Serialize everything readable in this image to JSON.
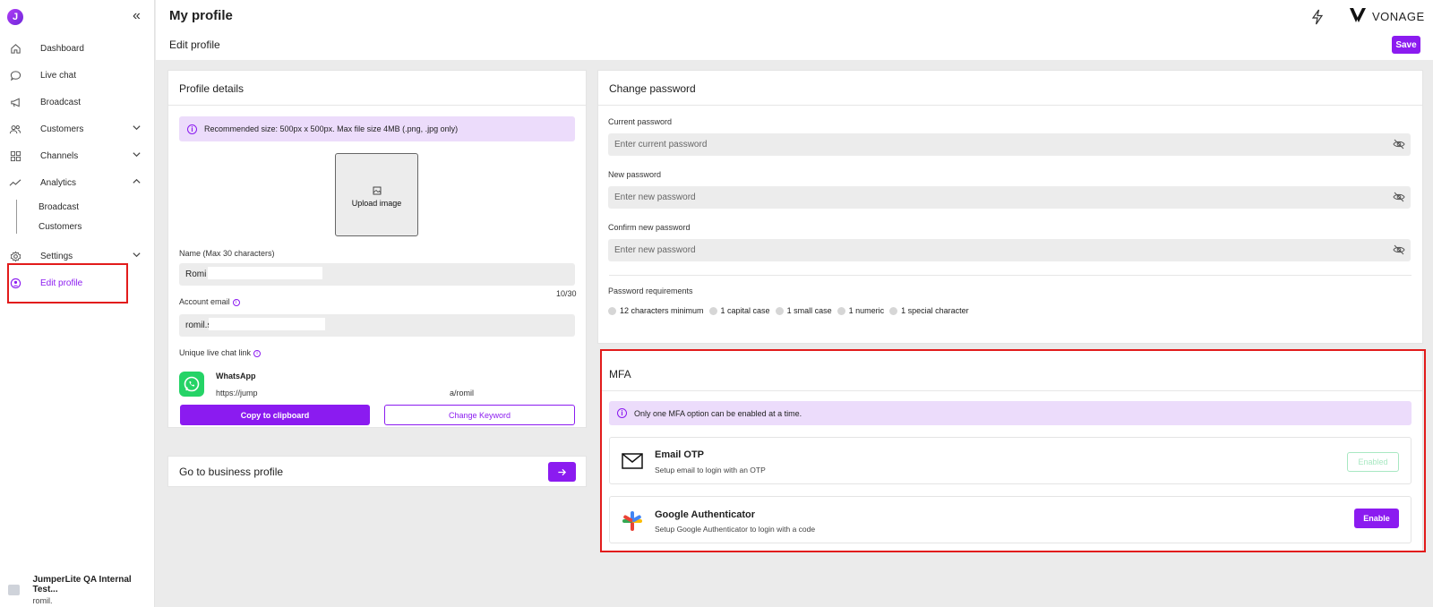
{
  "app": {
    "logo_letter": "J",
    "brand": "VONAGE",
    "accent_color": "#8b1bf0"
  },
  "sidebar": {
    "items": [
      {
        "label": "Dashboard",
        "icon": "home-icon"
      },
      {
        "label": "Live chat",
        "icon": "chat-icon"
      },
      {
        "label": "Broadcast",
        "icon": "megaphone-icon"
      },
      {
        "label": "Customers",
        "icon": "users-icon"
      },
      {
        "label": "Channels",
        "icon": "grid-icon"
      },
      {
        "label": "Analytics",
        "icon": "analytics-icon"
      },
      {
        "label": "Settings",
        "icon": "gear-icon"
      },
      {
        "label": "Edit profile",
        "icon": "profile-icon"
      }
    ],
    "analytics_sub": [
      "Broadcast",
      "Customers"
    ],
    "footer": {
      "title": "JumperLite QA Internal Test...",
      "subtitle": "romil."
    }
  },
  "header": {
    "title": "My profile",
    "subtitle": "Edit profile",
    "save_label": "Save"
  },
  "profile": {
    "title": "Profile details",
    "info": "Recommended size: 500px x 500px. Max file size 4MB (.png, .jpg only)",
    "upload_label": "Upload image",
    "name_label": "Name (Max 30 characters)",
    "name_value": "Romi",
    "name_counter": "10/30",
    "email_label": "Account email",
    "email_value": "romil.s",
    "link_label": "Unique live chat link",
    "whatsapp_name": "WhatsApp",
    "whatsapp_link_start": "https://jump",
    "whatsapp_link_end": "a/romil",
    "copy_label": "Copy to clipboard",
    "keyword_label": "Change Keyword"
  },
  "business": {
    "label": "Go to business profile"
  },
  "password": {
    "title": "Change password",
    "current_label": "Current password",
    "current_placeholder": "Enter current password",
    "new_label": "New password",
    "new_placeholder": "Enter new password",
    "confirm_label": "Confirm new password",
    "confirm_placeholder": "Enter new password",
    "requirements_label": "Password requirements",
    "requirements": [
      "12 characters minimum",
      "1 capital case",
      "1 small case",
      "1 numeric",
      "1 special character"
    ]
  },
  "mfa": {
    "title": "MFA",
    "info": "Only one MFA option can be enabled at a time.",
    "email_name": "Email OTP",
    "email_desc": "Setup email to login with an OTP",
    "email_status": "Enabled",
    "google_name": "Google Authenticator",
    "google_desc": "Setup Google Authenticator to login with a code",
    "google_action": "Enable"
  }
}
